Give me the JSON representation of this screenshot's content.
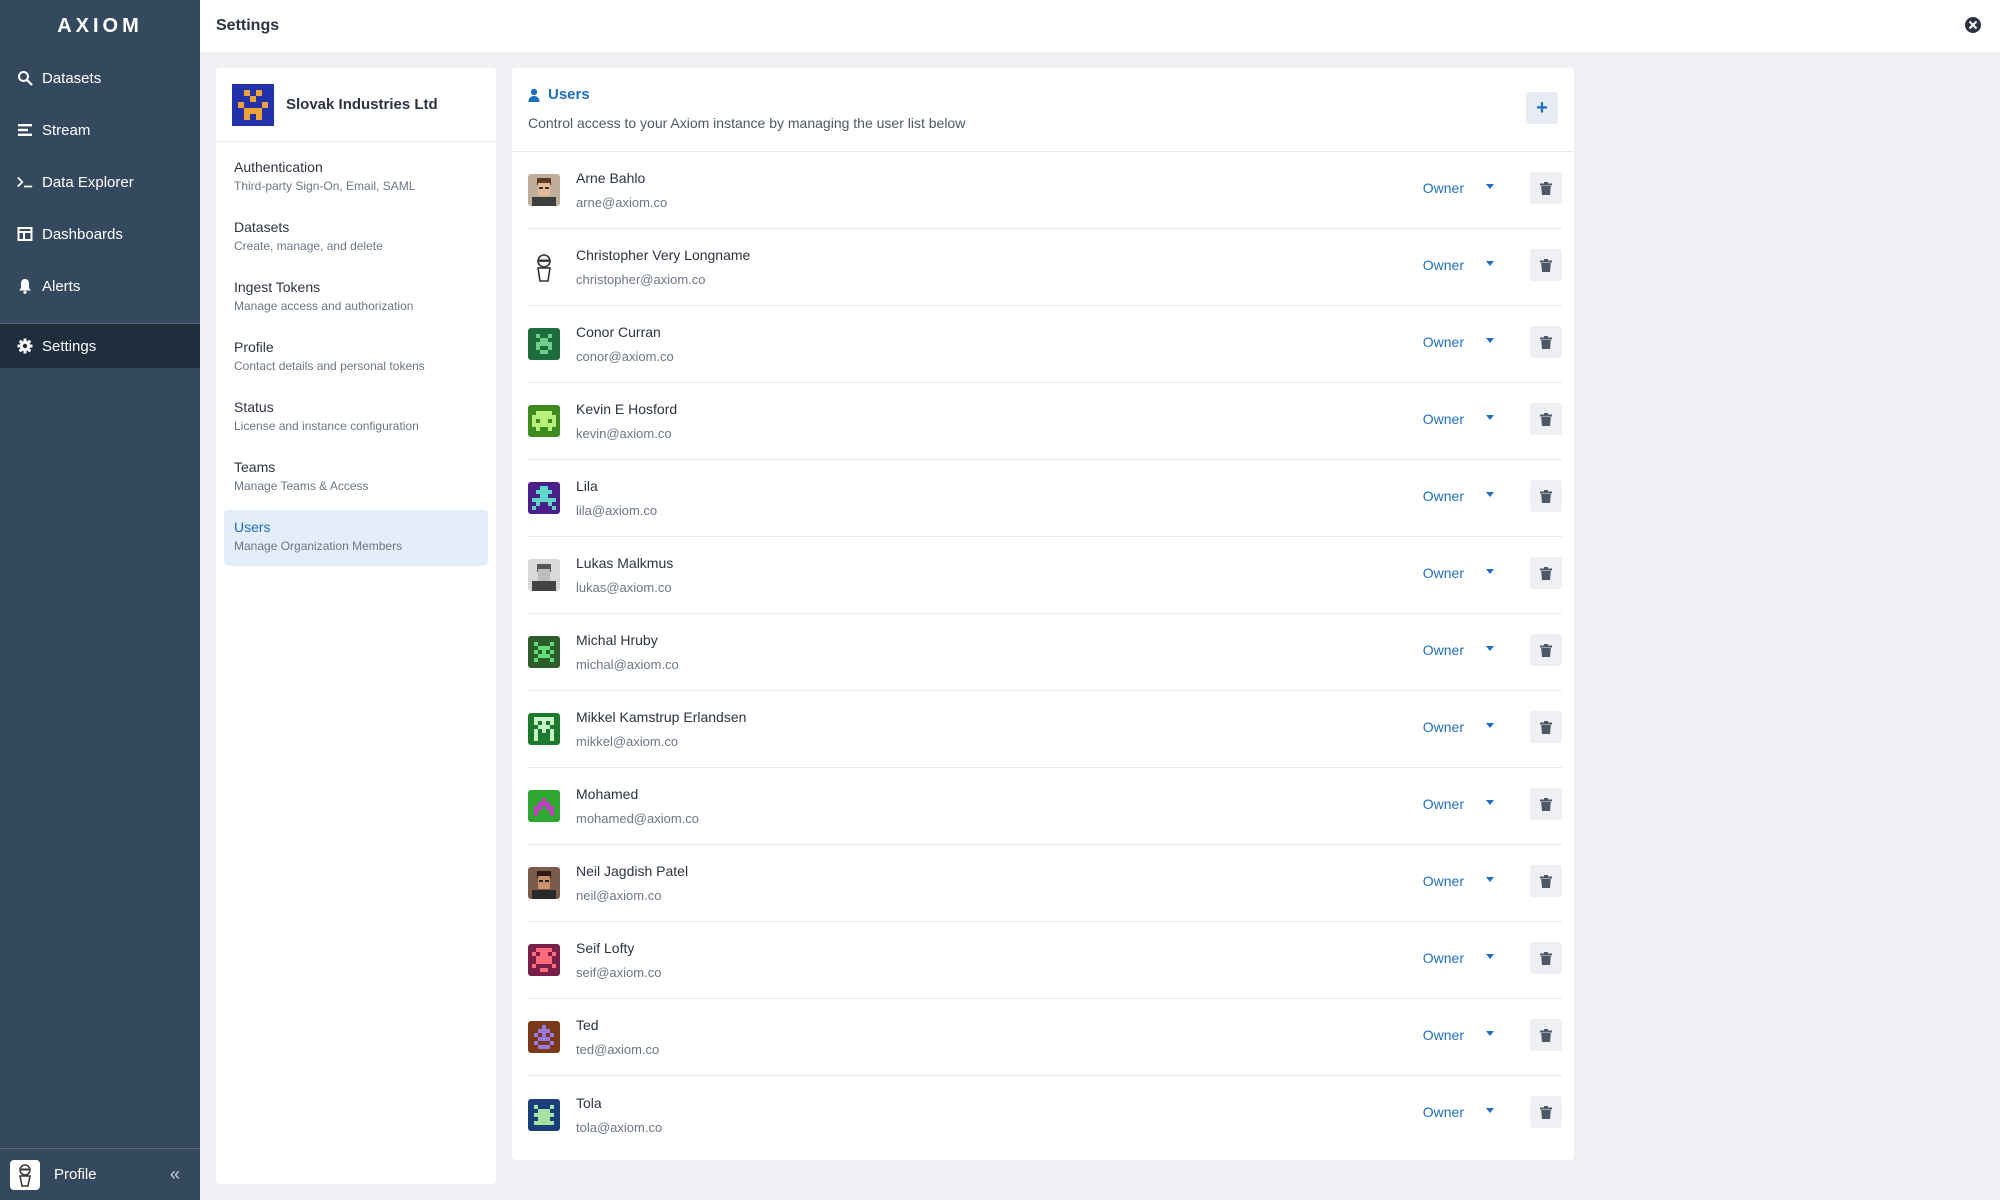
{
  "app": {
    "logo": "AXIOM"
  },
  "sidebar": {
    "items": [
      {
        "label": "Datasets",
        "icon": "search-icon"
      },
      {
        "label": "Stream",
        "icon": "stream-icon"
      },
      {
        "label": "Data Explorer",
        "icon": "terminal-icon"
      },
      {
        "label": "Dashboards",
        "icon": "dashboard-icon"
      },
      {
        "label": "Alerts",
        "icon": "bell-icon"
      }
    ],
    "active_item": {
      "label": "Settings",
      "icon": "gear-icon"
    },
    "profile_label": "Profile",
    "collapse_icon": "double-chevron-left-icon"
  },
  "header": {
    "title": "Settings",
    "close_icon": "close-circle-icon"
  },
  "settings": {
    "org_name": "Slovak Industries Ltd",
    "menu": [
      {
        "label": "Authentication",
        "description": "Third-party Sign-On, Email, SAML"
      },
      {
        "label": "Datasets",
        "description": "Create, manage, and delete"
      },
      {
        "label": "Ingest Tokens",
        "description": "Manage access and authorization"
      },
      {
        "label": "Profile",
        "description": "Contact details and personal tokens"
      },
      {
        "label": "Status",
        "description": "License and instance configuration"
      },
      {
        "label": "Teams",
        "description": "Manage Teams & Access"
      },
      {
        "label": "Users",
        "description": "Manage Organization Members"
      }
    ]
  },
  "users": {
    "title": "Users",
    "description": "Control access to your Axiom instance by managing the user list below",
    "add_label": "+",
    "role_label": "Owner",
    "list": [
      {
        "name": "Arne Bahlo",
        "email": "arne@axiom.co"
      },
      {
        "name": "Christopher Very Longname",
        "email": "christopher@axiom.co"
      },
      {
        "name": "Conor Curran",
        "email": "conor@axiom.co"
      },
      {
        "name": "Kevin E Hosford",
        "email": "kevin@axiom.co"
      },
      {
        "name": "Lila",
        "email": "lila@axiom.co"
      },
      {
        "name": "Lukas Malkmus",
        "email": "lukas@axiom.co"
      },
      {
        "name": "Michal Hruby",
        "email": "michal@axiom.co"
      },
      {
        "name": "Mikkel Kamstrup Erlandsen",
        "email": "mikkel@axiom.co"
      },
      {
        "name": "Mohamed",
        "email": "mohamed@axiom.co"
      },
      {
        "name": "Neil Jagdish Patel",
        "email": "neil@axiom.co"
      },
      {
        "name": "Seif Lofty",
        "email": "seif@axiom.co"
      },
      {
        "name": "Ted",
        "email": "ted@axiom.co"
      },
      {
        "name": "Tola",
        "email": "tola@axiom.co"
      }
    ]
  },
  "colors": {
    "sidebar": "#34495e",
    "accent": "#1f6fbf",
    "active_menu_bg": "#e3eef9"
  }
}
